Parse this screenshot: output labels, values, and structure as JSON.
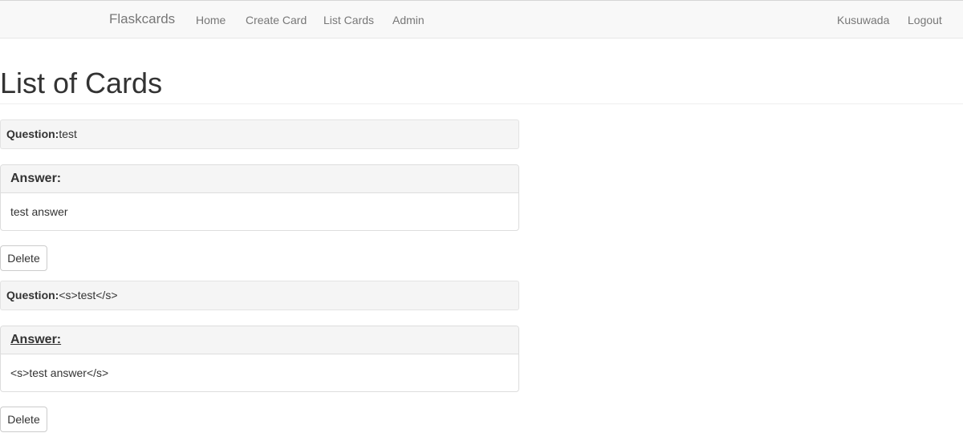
{
  "navbar": {
    "brand": "Flaskcards",
    "links": [
      "Home",
      "Create Card",
      "List Cards",
      "Admin"
    ],
    "user": "Kusuwada",
    "logout": "Logout"
  },
  "page": {
    "title": "List of Cards"
  },
  "cards": [
    {
      "question_label": "Question:",
      "question": "test",
      "answer_label": "Answer:",
      "answer": "test answer",
      "delete_label": "Delete"
    },
    {
      "question_label": "Question:",
      "question": "<s>test</s>",
      "answer_label": "Answer:",
      "answer": "<s>test answer</s>",
      "delete_label": "Delete"
    }
  ]
}
